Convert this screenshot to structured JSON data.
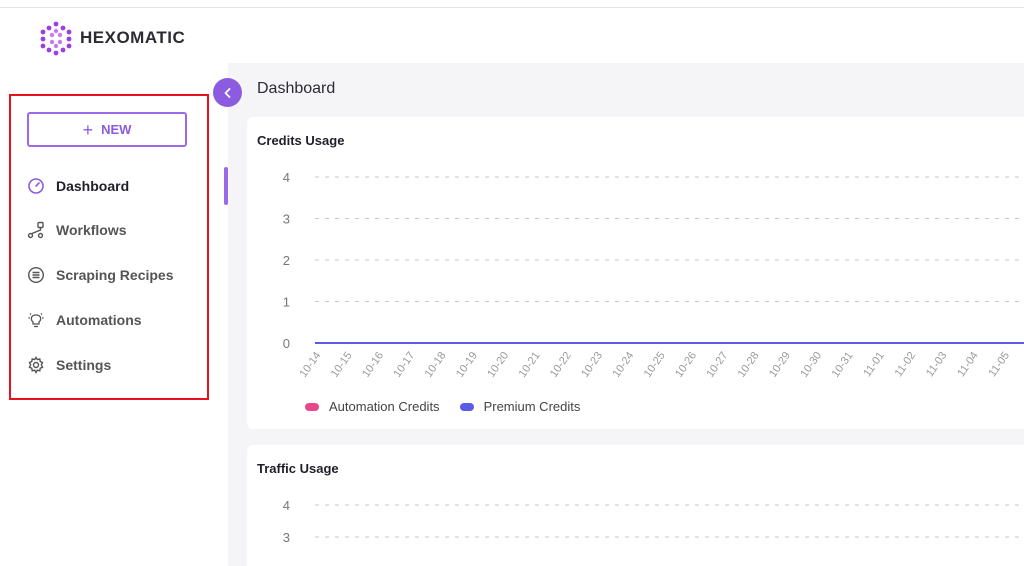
{
  "brand": {
    "name": "HEXOMATIC",
    "accent": "#8b5ce0"
  },
  "sidebar": {
    "new_button": {
      "label": "NEW",
      "icon": "plus-icon"
    },
    "items": [
      {
        "label": "Dashboard",
        "icon": "dashboard-gauge-icon",
        "active": true
      },
      {
        "label": "Workflows",
        "icon": "workflow-icon",
        "active": false
      },
      {
        "label": "Scraping Recipes",
        "icon": "recipe-list-icon",
        "active": false
      },
      {
        "label": "Automations",
        "icon": "lightbulb-icon",
        "active": false
      },
      {
        "label": "Settings",
        "icon": "gear-icon",
        "active": false
      }
    ]
  },
  "page": {
    "title": "Dashboard"
  },
  "cards": {
    "credits": {
      "title": "Credits Usage"
    },
    "traffic": {
      "title": "Traffic Usage"
    }
  },
  "chart_data": [
    {
      "type": "line",
      "title": "Credits Usage",
      "xlabel": "",
      "ylabel": "",
      "ylim": [
        0,
        4
      ],
      "yticks": [
        0,
        1,
        2,
        3,
        4
      ],
      "grid": true,
      "legend_position": "bottom-left",
      "categories": [
        "10-14",
        "10-15",
        "10-16",
        "10-17",
        "10-18",
        "10-19",
        "10-20",
        "10-21",
        "10-22",
        "10-23",
        "10-24",
        "10-25",
        "10-26",
        "10-27",
        "10-28",
        "10-29",
        "10-30",
        "10-31",
        "11-01",
        "11-02",
        "11-03",
        "11-04",
        "11-05"
      ],
      "series": [
        {
          "name": "Automation Credits",
          "color": "#e8488a",
          "values": [
            0,
            0,
            0,
            0,
            0,
            0,
            0,
            0,
            0,
            0,
            0,
            0,
            0,
            0,
            0,
            0,
            0,
            0,
            0,
            0,
            0,
            0,
            0
          ]
        },
        {
          "name": "Premium Credits",
          "color": "#5b5be8",
          "values": [
            0,
            0,
            0,
            0,
            0,
            0,
            0,
            0,
            0,
            0,
            0,
            0,
            0,
            0,
            0,
            0,
            0,
            0,
            0,
            0,
            0,
            0,
            0
          ]
        }
      ]
    },
    {
      "type": "line",
      "title": "Traffic Usage",
      "xlabel": "",
      "ylabel": "",
      "yticks": [
        3,
        4
      ],
      "grid": true,
      "series": []
    }
  ]
}
